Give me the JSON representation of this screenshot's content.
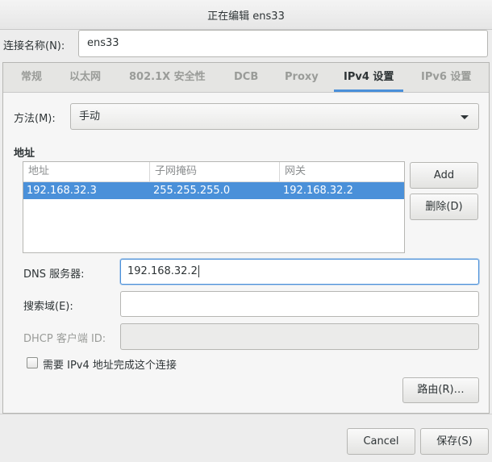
{
  "window": {
    "title": "正在编辑 ens33"
  },
  "connection": {
    "name_label": "连接名称(N):",
    "name_value": "ens33"
  },
  "tabs": [
    {
      "label": "常规",
      "active": false
    },
    {
      "label": "以太网",
      "active": false
    },
    {
      "label": "802.1X 安全性",
      "active": false
    },
    {
      "label": "DCB",
      "active": false
    },
    {
      "label": "Proxy",
      "active": false
    },
    {
      "label": "IPv4 设置",
      "active": true
    },
    {
      "label": "IPv6 设置",
      "active": false
    }
  ],
  "ipv4": {
    "method_label": "方法(M):",
    "method_value": "手动",
    "addresses_heading": "地址",
    "table": {
      "columns": [
        "地址",
        "子网掩码",
        "网关"
      ],
      "rows": [
        {
          "address": "192.168.32.3",
          "netmask": "255.255.255.0",
          "gateway": "192.168.32.2",
          "selected": true
        }
      ]
    },
    "add_button": "Add",
    "delete_button": "删除(D)",
    "dns_label": "DNS 服务器:",
    "dns_value": "192.168.32.2",
    "search_label": "搜索域(E):",
    "search_value": "",
    "dhcp_label": "DHCP 客户端 ID:",
    "dhcp_value": "",
    "require_label": "需要 IPv4 地址完成这个连接",
    "require_checked": false,
    "routes_button": "路由(R)…"
  },
  "footer": {
    "cancel_button": "Cancel",
    "save_button": "保存(S)"
  },
  "colors": {
    "accent": "#4a90d9",
    "selection": "#4a90d9",
    "background": "#ededed"
  }
}
